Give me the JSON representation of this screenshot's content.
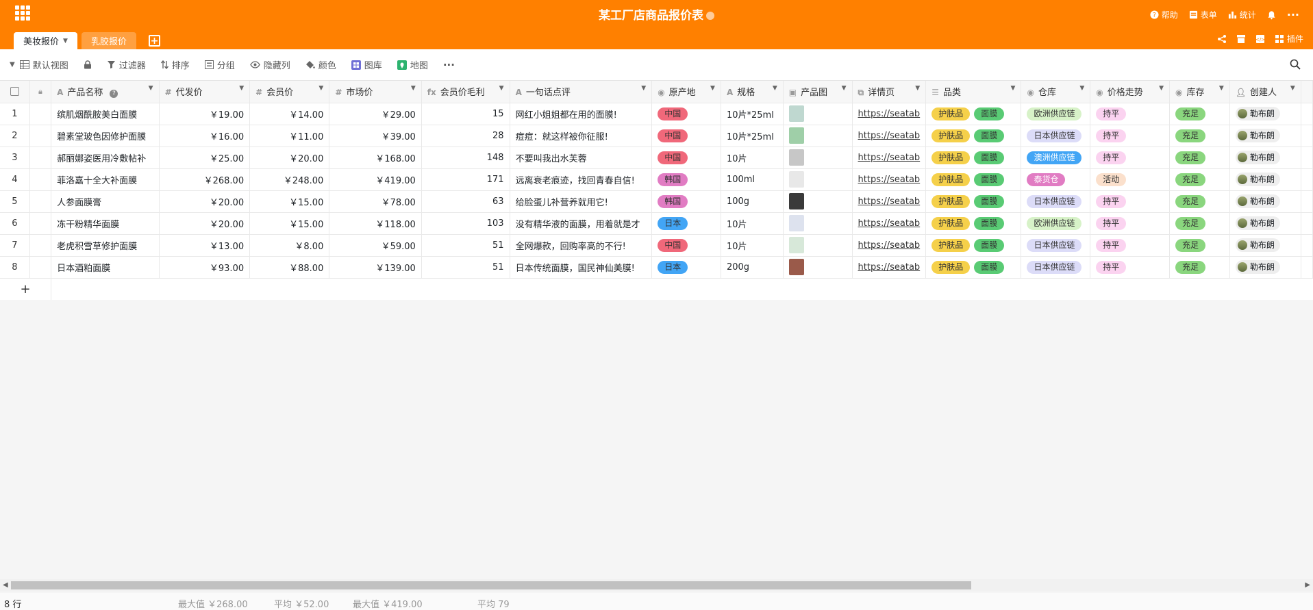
{
  "header": {
    "title": "某工厂店商品报价表",
    "actions": [
      {
        "label": "帮助",
        "icon": "help-icon"
      },
      {
        "label": "表单",
        "icon": "form-icon"
      },
      {
        "label": "统计",
        "icon": "stats-icon"
      }
    ],
    "plugin_label": "插件"
  },
  "tabs": [
    {
      "label": "美妆报价",
      "active": true
    },
    {
      "label": "乳胶报价",
      "active": false
    }
  ],
  "toolbar": {
    "view_label": "默认视图",
    "filter_label": "过滤器",
    "sort_label": "排序",
    "group_label": "分组",
    "hide_label": "隐藏列",
    "color_label": "颜色",
    "gallery_label": "图库",
    "map_label": "地图"
  },
  "columns": [
    {
      "label": "产品名称",
      "icon": "A"
    },
    {
      "label": "代发价",
      "icon": "#"
    },
    {
      "label": "会员价",
      "icon": "#"
    },
    {
      "label": "市场价",
      "icon": "#"
    },
    {
      "label": "会员价毛利",
      "icon": "fx"
    },
    {
      "label": "一句话点评",
      "icon": "A"
    },
    {
      "label": "原产地",
      "icon": "▾"
    },
    {
      "label": "规格",
      "icon": "A"
    },
    {
      "label": "产品图",
      "icon": "img"
    },
    {
      "label": "详情页",
      "icon": "link"
    },
    {
      "label": "品类",
      "icon": "list"
    },
    {
      "label": "仓库",
      "icon": "▾"
    },
    {
      "label": "价格走势",
      "icon": "▾"
    },
    {
      "label": "库存",
      "icon": "▾"
    },
    {
      "label": "创建人",
      "icon": "user"
    }
  ],
  "rows": [
    {
      "no": "1",
      "name": "缤肌烟酰胺美白面膜",
      "wholesale": "￥19.00",
      "member": "￥14.00",
      "market": "￥29.00",
      "margin": "15",
      "comment": "网红小姐姐都在用的面膜!",
      "origin": "中国",
      "spec": "10片*25ml",
      "link": "https://seatab",
      "cat1": "护肤品",
      "cat2": "面膜",
      "warehouse": "欧洲供应链",
      "trend": "持平",
      "stock": "充足",
      "creator": "勒布朗"
    },
    {
      "no": "2",
      "name": "碧素堂玻色因修护面膜",
      "wholesale": "￥16.00",
      "member": "￥11.00",
      "market": "￥39.00",
      "margin": "28",
      "comment": "痘痘：就这样被你征服!",
      "origin": "中国",
      "spec": "10片*25ml",
      "link": "https://seatab",
      "cat1": "护肤品",
      "cat2": "面膜",
      "warehouse": "日本供应链",
      "trend": "持平",
      "stock": "充足",
      "creator": "勒布朗"
    },
    {
      "no": "3",
      "name": "郝丽娜姿医用冷敷帖补",
      "wholesale": "￥25.00",
      "member": "￥20.00",
      "market": "￥168.00",
      "margin": "148",
      "comment": "不要叫我出水芙蓉",
      "origin": "中国",
      "spec": "10片",
      "link": "https://seatab",
      "cat1": "护肤品",
      "cat2": "面膜",
      "warehouse": "澳洲供应链",
      "trend": "持平",
      "stock": "充足",
      "creator": "勒布朗"
    },
    {
      "no": "4",
      "name": "菲洛嘉十全大补面膜",
      "wholesale": "￥268.00",
      "member": "￥248.00",
      "market": "￥419.00",
      "margin": "171",
      "comment": "远离衰老痕迹，找回青春自信!",
      "origin": "韩国",
      "spec": "100ml",
      "link": "https://seatab",
      "cat1": "护肤品",
      "cat2": "面膜",
      "warehouse": "泰货仓",
      "trend": "活动",
      "stock": "充足",
      "creator": "勒布朗"
    },
    {
      "no": "5",
      "name": "人参面膜膏",
      "wholesale": "￥20.00",
      "member": "￥15.00",
      "market": "￥78.00",
      "margin": "63",
      "comment": "给脸蛋儿补营养就用它!",
      "origin": "韩国",
      "spec": "100g",
      "link": "https://seatab",
      "cat1": "护肤品",
      "cat2": "面膜",
      "warehouse": "日本供应链",
      "trend": "持平",
      "stock": "充足",
      "creator": "勒布朗"
    },
    {
      "no": "6",
      "name": "冻干粉精华面膜",
      "wholesale": "￥20.00",
      "member": "￥15.00",
      "market": "￥118.00",
      "margin": "103",
      "comment": "没有精华液的面膜，用着就是才",
      "origin": "日本",
      "spec": "10片",
      "link": "https://seatab",
      "cat1": "护肤品",
      "cat2": "面膜",
      "warehouse": "欧洲供应链",
      "trend": "持平",
      "stock": "充足",
      "creator": "勒布朗"
    },
    {
      "no": "7",
      "name": "老虎积雪草修护面膜",
      "wholesale": "￥13.00",
      "member": "￥8.00",
      "market": "￥59.00",
      "margin": "51",
      "comment": "全网爆款，回购率高的不行!",
      "origin": "中国",
      "spec": "10片",
      "link": "https://seatab",
      "cat1": "护肤品",
      "cat2": "面膜",
      "warehouse": "日本供应链",
      "trend": "持平",
      "stock": "充足",
      "creator": "勒布朗"
    },
    {
      "no": "8",
      "name": "日本酒粕面膜",
      "wholesale": "￥93.00",
      "member": "￥88.00",
      "market": "￥139.00",
      "margin": "51",
      "comment": "日本传统面膜，国民神仙美膜!",
      "origin": "日本",
      "spec": "200g",
      "link": "https://seatab",
      "cat1": "护肤品",
      "cat2": "面膜",
      "warehouse": "日本供应链",
      "trend": "持平",
      "stock": "充足",
      "creator": "勒布朗"
    }
  ],
  "pill_colors": {
    "中国": "#f0687a",
    "韩国": "#e17cc3",
    "日本": "#42a5f5",
    "护肤品": "#f5d04a",
    "面膜": "#59cb74",
    "欧洲供应链": "#d7f2c8",
    "日本供应链": "#dcdcf8",
    "澳洲供应链": "#42a5f5",
    "泰货仓": "#e17cc3",
    "持平": "#fbd3f0",
    "活动": "#fbe0cc",
    "充足": "#8ad67e"
  },
  "thumb_colors": [
    "#bfd8d0",
    "#9fcfa8",
    "#c7c7c7",
    "#e8e8e8",
    "#3a3a3a",
    "#dde2ee",
    "#d7e8d9",
    "#9a5a4a"
  ],
  "footer": {
    "row_count": "8 行",
    "stat1": "最大值 ￥268.00",
    "stat2": "平均 ￥52.00",
    "stat3": "最大值 ￥419.00",
    "stat4": "平均 79"
  }
}
